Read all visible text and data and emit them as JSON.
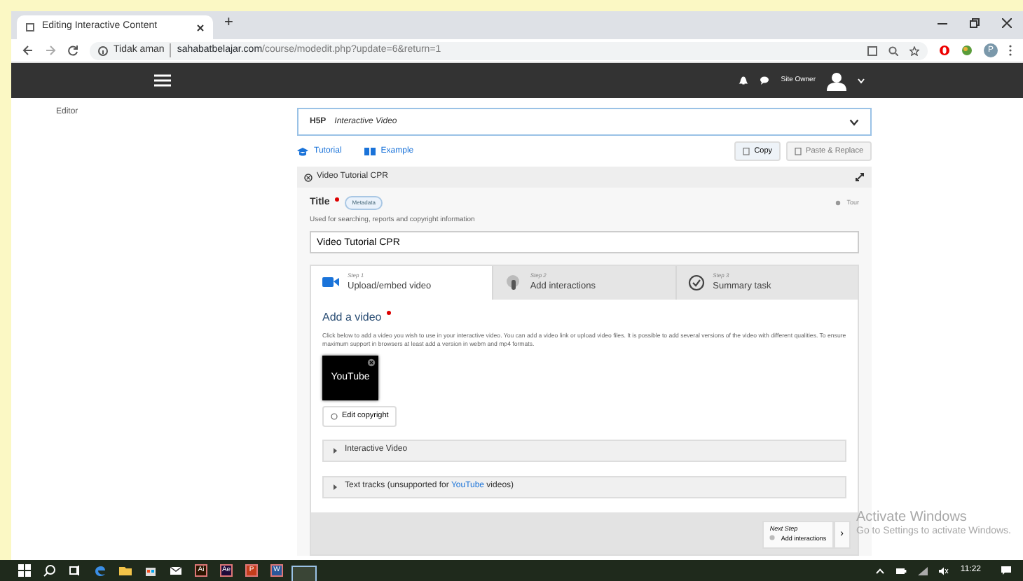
{
  "browser": {
    "tab_title": "Editing Interactive Content",
    "new_tab": "+",
    "security": "Tidak aman",
    "url_host": "sahabatbelajar.com",
    "url_path": "/course/modedit.php?update=6&return=1",
    "profile": "P"
  },
  "navbar": {
    "user": "Site Owner"
  },
  "sidebar": {
    "label": "Editor"
  },
  "content_type": {
    "logo": "H5P",
    "name": "Interactive Video"
  },
  "links": [
    {
      "label": "Tutorial",
      "kind": "tutorial"
    },
    {
      "label": "Example",
      "kind": "example"
    }
  ],
  "actions": [
    {
      "label": "Copy",
      "disabled": false
    },
    {
      "label": "Paste & Replace",
      "disabled": true
    }
  ],
  "section": {
    "title": "Video Tutorial CPR"
  },
  "title_field": {
    "label": "Title",
    "required": true,
    "metadata": "Metadata",
    "tour": "Tour",
    "help": "Used for searching, reports and copyright information",
    "value": "Video Tutorial CPR"
  },
  "steps": [
    {
      "step": "Step 1",
      "label": "Upload/embed video",
      "kind": "video",
      "selected": true
    },
    {
      "step": "Step 2",
      "label": "Add interactions",
      "kind": "hand",
      "selected": false
    },
    {
      "step": "Step 3",
      "label": "Summary task",
      "kind": "check",
      "selected": false
    }
  ],
  "video": {
    "heading": "Add a video",
    "required": true,
    "description": "Click below to add a video you wish to use in your interactive video. You can add a video link or upload video files. It is possible to add several versions of the video with different qualities. To ensure maximum support in browsers at least add a version in webm and mp4 formats.",
    "thumbnail": "YouTube",
    "edit_copyright": "Edit copyright"
  },
  "accordions": [
    {
      "before": "Interactive Video",
      "expanded": false
    },
    {
      "before": "Text tracks (unsupported for ",
      "link": "YouTube",
      "after": " videos)",
      "expanded": false
    }
  ],
  "next_step": {
    "caption": "Next Step",
    "label": "Add interactions",
    "arrow": "›"
  },
  "os_notice": {
    "title": "Activate Windows",
    "text": "Go to Settings to activate Windows."
  },
  "taskbar": {
    "apps": [
      {
        "kind": "edge"
      },
      {
        "kind": "folder"
      },
      {
        "kind": "store"
      },
      {
        "kind": "mail"
      },
      {
        "kind": "letter",
        "label": "Ai",
        "color": "#2b1500"
      },
      {
        "kind": "letter",
        "label": "Ae",
        "color": "#1f0a3a"
      },
      {
        "kind": "letter",
        "label": "P",
        "color": "#c43e1c"
      },
      {
        "kind": "letter",
        "label": "W",
        "color": "#2b579a"
      },
      {
        "kind": "chrome",
        "selected": true
      }
    ],
    "time": "11:22"
  }
}
